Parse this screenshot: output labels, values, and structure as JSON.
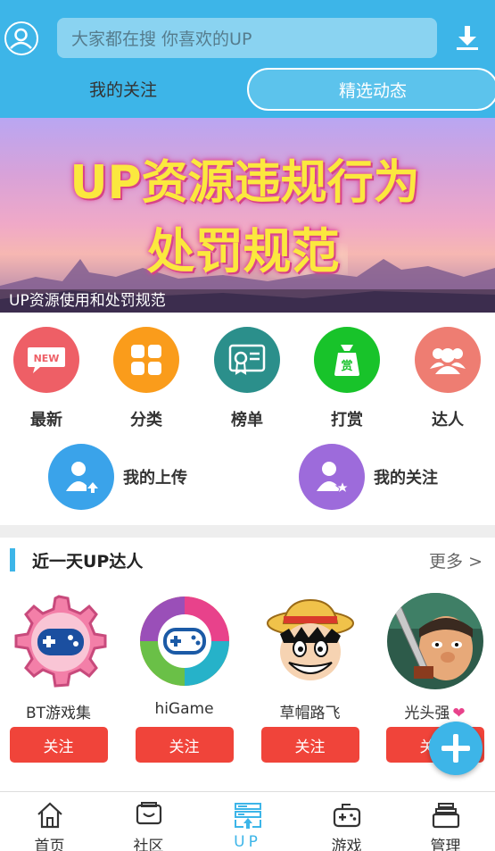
{
  "header": {
    "search_placeholder": "大家都在搜  你喜欢的UP",
    "tabs": [
      {
        "label": "我的关注",
        "active": false
      },
      {
        "label": "精选动态",
        "active": true
      }
    ],
    "accent_color": "#3db5e8"
  },
  "banner": {
    "title_line1": "UP资源违规行为",
    "title_line2": "处罚规范",
    "caption": "UP资源使用和处罚规范"
  },
  "categories": [
    {
      "label": "最新",
      "icon": "new-icon",
      "color": "#ee5f66"
    },
    {
      "label": "分类",
      "icon": "grid-icon",
      "color": "#fa9c1b"
    },
    {
      "label": "榜单",
      "icon": "certificate-icon",
      "color": "#2b8f8b"
    },
    {
      "label": "打赏",
      "icon": "money-bag-icon",
      "color": "#18c32a"
    },
    {
      "label": "达人",
      "icon": "group-icon",
      "color": "#ee7d72"
    }
  ],
  "quick_links": [
    {
      "label": "我的上传",
      "icon": "user-upload-icon",
      "color": "#3aa3ea"
    },
    {
      "label": "我的关注",
      "icon": "user-star-icon",
      "color": "#9d6bdb"
    }
  ],
  "up_section": {
    "title": "近一天UP达人",
    "more": "更多 >",
    "users": [
      {
        "name": "BT游戏集",
        "follow": "关注"
      },
      {
        "name": "hiGame",
        "follow": "关注"
      },
      {
        "name": "草帽路飞",
        "follow": "关注"
      },
      {
        "name": "光头强",
        "follow": "关注",
        "badge": "❤"
      }
    ]
  },
  "nav": [
    {
      "label": "首页",
      "icon": "home-icon"
    },
    {
      "label": "社区",
      "icon": "community-icon"
    },
    {
      "label": "UP",
      "icon": "up-icon",
      "active": true
    },
    {
      "label": "游戏",
      "icon": "gamepad-icon"
    },
    {
      "label": "管理",
      "icon": "manage-icon"
    }
  ]
}
